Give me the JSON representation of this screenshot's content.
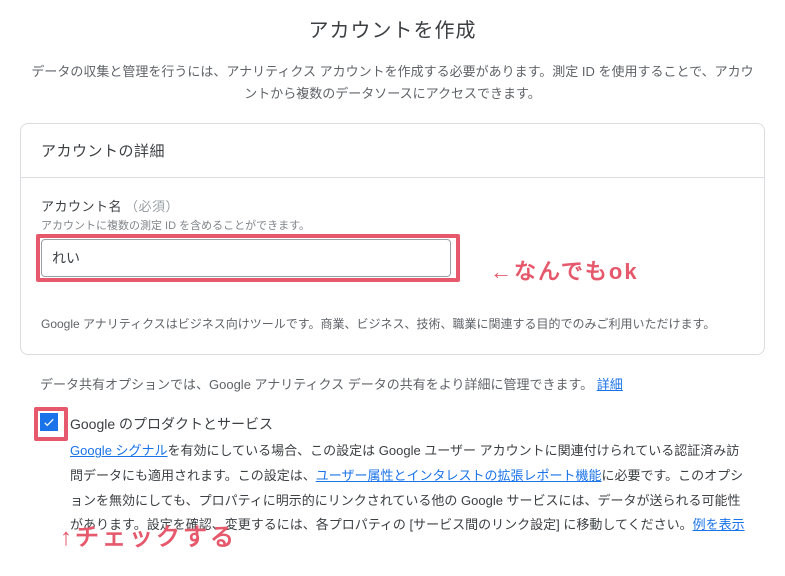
{
  "page": {
    "title": "アカウントを作成",
    "subtitle": "データの収集と管理を行うには、アナリティクス アカウントを作成する必要があります。測定 ID を使用することで、アカウントから複数のデータソースにアクセスできます。"
  },
  "account_details": {
    "header": "アカウントの詳細",
    "name_label": "アカウント名",
    "required_label": "（必須）",
    "name_hint": "アカウントに複数の測定 ID を含めることができます。",
    "name_value": "れい",
    "footnote": "Google アナリティクスはビジネス向けツールです。商業、ビジネス、技術、職業に関連する目的でのみご利用いただけます。"
  },
  "data_sharing": {
    "intro_prefix": "データ共有オプションでは、Google アナリティクス データの共有をより詳細に管理できます。",
    "intro_link": "詳細",
    "item": {
      "title": "Google のプロダクトとサービス",
      "text_prefix": "",
      "link1": "Google シグナル",
      "text_mid1": "を有効にしている場合、この設定は Google ユーザー アカウントに関連付けられている認証済み訪問データにも適用されます。この設定は、",
      "link2": "ユーザー属性とインタレストの拡張レポート機能",
      "text_mid2": "に必要です。このオプションを無効にしても、プロパティに明示的にリンクされている他の Google サービスには、データが送られる可能性があります。設定を確認、変更するには、各プロパティの [サービス間のリンク設定] に移動してください。",
      "link3": "例を表示",
      "checked": true
    }
  },
  "annotations": {
    "anything_ok": "←なんでもok",
    "check_this": "↑チェックする"
  }
}
